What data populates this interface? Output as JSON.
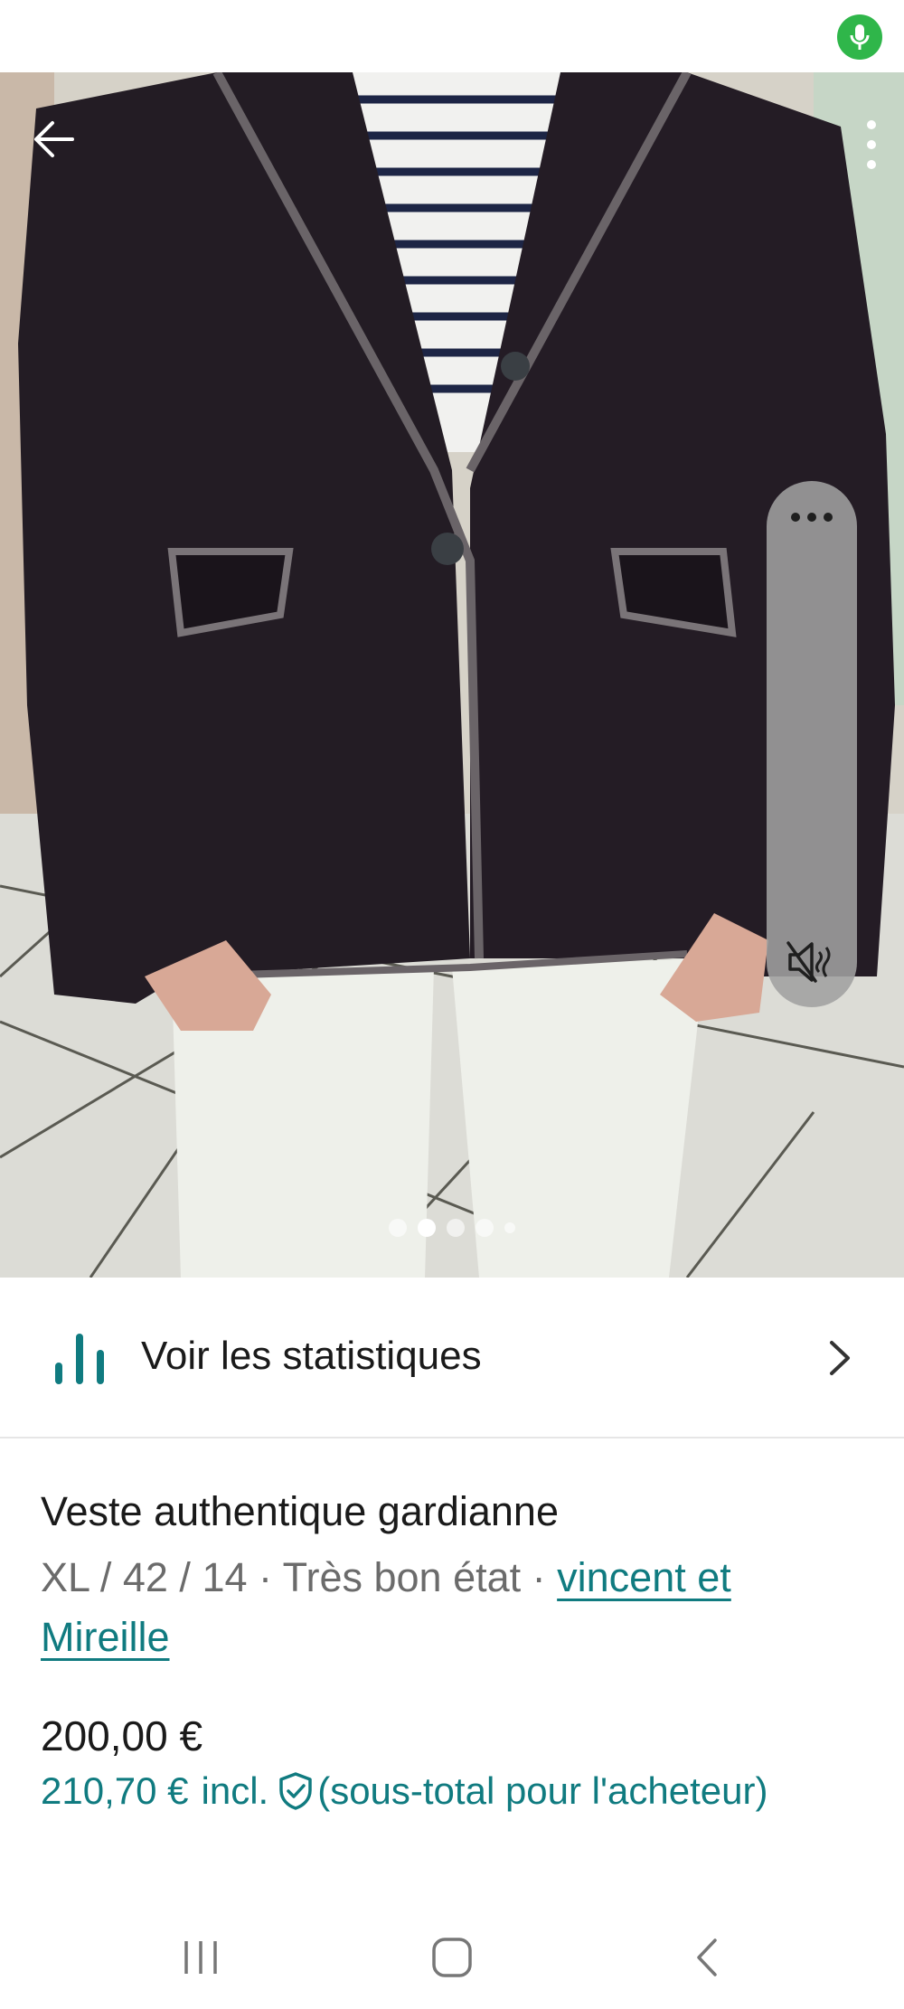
{
  "listing": {
    "stats_label": "Voir les statistiques",
    "title": "Veste authentique gardianne",
    "meta_prefix": "XL / 42 / 14 · Très bon état · ",
    "brand": "vincent et Mireille",
    "price": "200,00 €",
    "price_total": "210,70 €",
    "price_incl": "incl.",
    "price_note": "(sous-total pour l'acheteur)"
  },
  "gallery": {
    "dots": 5,
    "active_index": 1
  },
  "colors": {
    "accent": "#107b80",
    "mic_green": "#2fb64a",
    "text_primary": "#1a1a1a",
    "text_secondary": "#6b6b6b"
  },
  "icons": {
    "status": "mic-icon",
    "back": "arrow-left-icon",
    "more": "more-vertical-icon",
    "panel_more": "more-horizontal-icon",
    "panel_mute": "volume-mute-icon",
    "stats": "bar-chart-icon",
    "chevron": "chevron-right-icon",
    "shield": "shield-check-icon",
    "nav_recents": "recents-icon",
    "nav_home": "home-icon",
    "nav_back": "nav-back-icon"
  }
}
